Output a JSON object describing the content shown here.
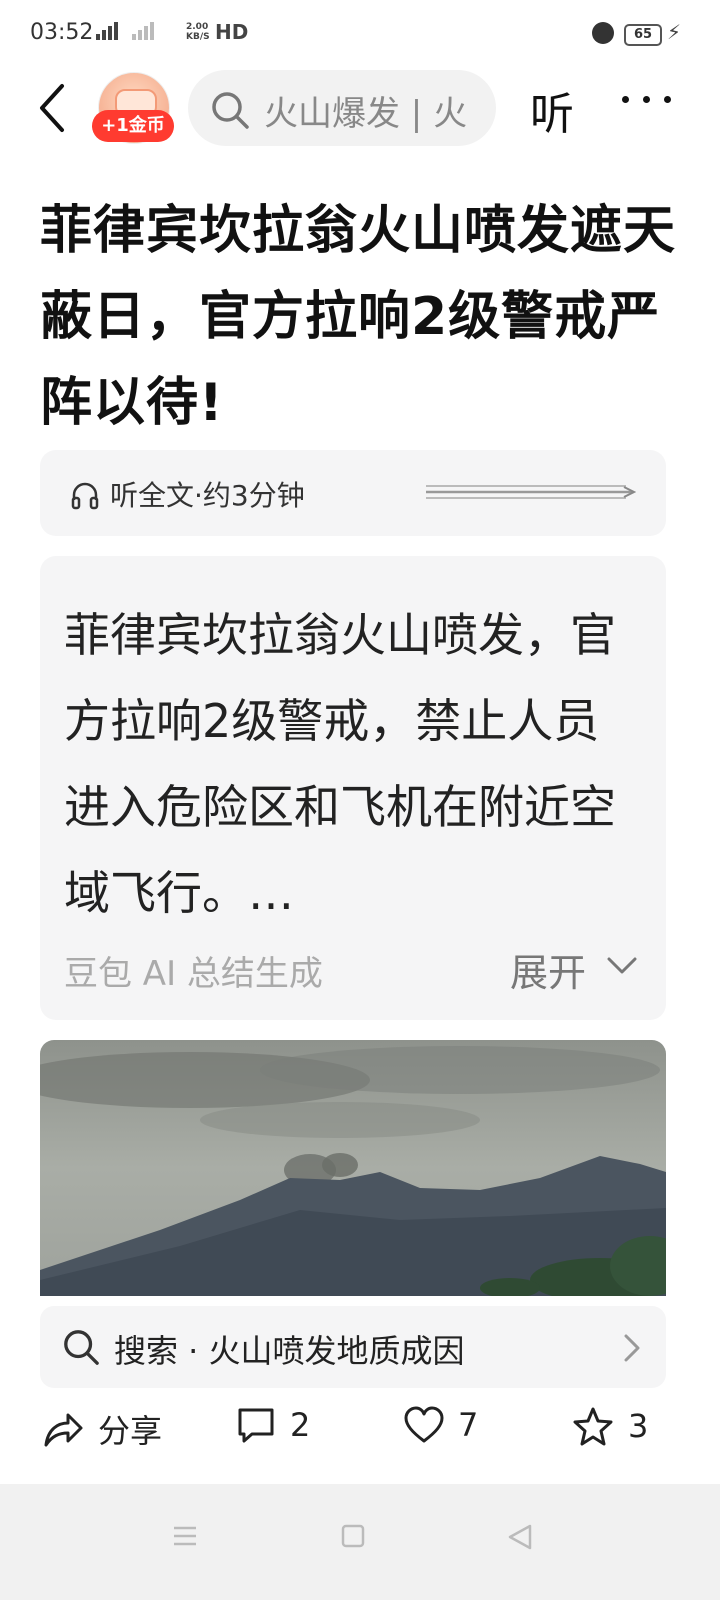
{
  "status_bar": {
    "time": "03:52",
    "network_top": "2.00",
    "network_bottom": "KB/S",
    "hd": "HD",
    "battery": "65"
  },
  "top_bar": {
    "coin_badge": "+1金币",
    "search_text": "火山爆发 | 火",
    "listen_label": "听"
  },
  "article": {
    "title": "菲律宾坎拉翁火山喷发遮天蔽日，官方拉响2级警戒严阵以待!",
    "listen_text": "听全文·约3分钟",
    "summary_text": "菲律宾坎拉翁火山喷发，官方拉响2级警戒，禁止人员进入危险区和飞机在附近空域飞行。…",
    "summary_source": "豆包 AI 总结生成",
    "expand_label": "展开"
  },
  "suggestion": {
    "text": "搜索 · 火山喷发地质成因"
  },
  "actions": {
    "share_label": "分享",
    "comment_count": "2",
    "like_count": "7",
    "favorite_count": "3"
  },
  "colors": {
    "badge_red": "#ff3b30",
    "card_bg": "#f5f5f6",
    "nav_bg": "#f1f1f1"
  }
}
